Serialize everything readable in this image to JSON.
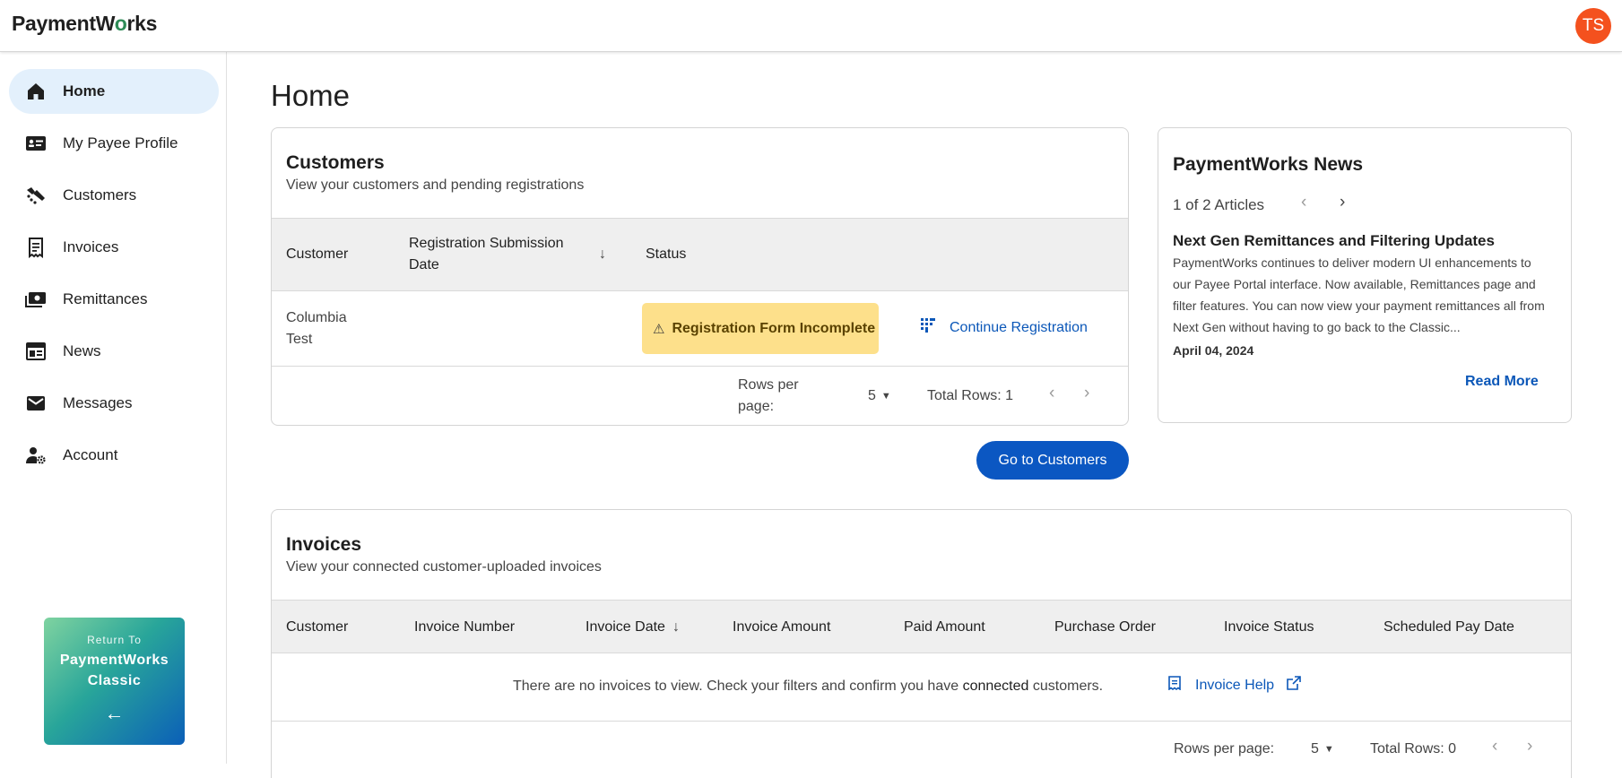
{
  "app": {
    "logo_prefix": "PaymentW",
    "logo_o": "o",
    "logo_suffix": "rks",
    "avatar_initials": "TS"
  },
  "sidebar": {
    "items": [
      {
        "label": "Home",
        "icon": "home-icon",
        "active": true
      },
      {
        "label": "My Payee Profile",
        "icon": "id-card-icon"
      },
      {
        "label": "Customers",
        "icon": "handshake-icon"
      },
      {
        "label": "Invoices",
        "icon": "receipt-icon"
      },
      {
        "label": "Remittances",
        "icon": "cash-icon"
      },
      {
        "label": "News",
        "icon": "newspaper-icon"
      },
      {
        "label": "Messages",
        "icon": "mail-icon"
      },
      {
        "label": "Account",
        "icon": "user-gear-icon"
      }
    ],
    "classic": {
      "small": "Return To",
      "line1": "PaymentWorks",
      "line2": "Classic",
      "arrow": "←"
    }
  },
  "page": {
    "title": "Home"
  },
  "customers": {
    "title": "Customers",
    "subtitle": "View your customers and pending registrations",
    "columns": [
      "Customer",
      "Registration Submission Date",
      "Status"
    ],
    "sort_arrow": "↓",
    "rows": [
      {
        "customer": "Columbia Test",
        "date": "",
        "status": "Registration Form Incomplete",
        "action": "Continue Registration"
      }
    ],
    "pager": {
      "rows_per_page_label": "Rows per page:",
      "rows_per_page": "5",
      "total": "Total Rows: 1"
    },
    "button": "Go to Customers"
  },
  "news": {
    "title": "PaymentWorks News",
    "counter": "1 of 2 Articles",
    "article_title": "Next Gen Remittances and Filtering Updates",
    "article_body": "PaymentWorks continues to deliver modern UI enhancements to our Payee Portal interface. Now available, Remittances page and filter features. You can now view your payment remittances all from Next Gen without having to go back to the Classic...",
    "article_date": "April 04, 2024",
    "read_more": "Read More"
  },
  "invoices": {
    "title": "Invoices",
    "subtitle": "View your connected customer-uploaded invoices",
    "columns": [
      "Customer",
      "Invoice Number",
      "Invoice Date",
      "Invoice Amount",
      "Paid Amount",
      "Purchase Order",
      "Invoice Status",
      "Scheduled Pay Date"
    ],
    "sort_arrow": "↓",
    "empty_prefix": "There are no invoices to view. Check your filters and confirm you have ",
    "empty_bold": "connected",
    "empty_suffix": " customers.",
    "help_link": "Invoice Help",
    "pager": {
      "rows_per_page_label": "Rows per page:",
      "rows_per_page": "5",
      "total": "Total Rows: 0"
    }
  },
  "colors": {
    "primary": "#0b57c2",
    "active_nav": "#e3f0fc",
    "badge": "#fde08b",
    "avatar": "#f4511e"
  }
}
